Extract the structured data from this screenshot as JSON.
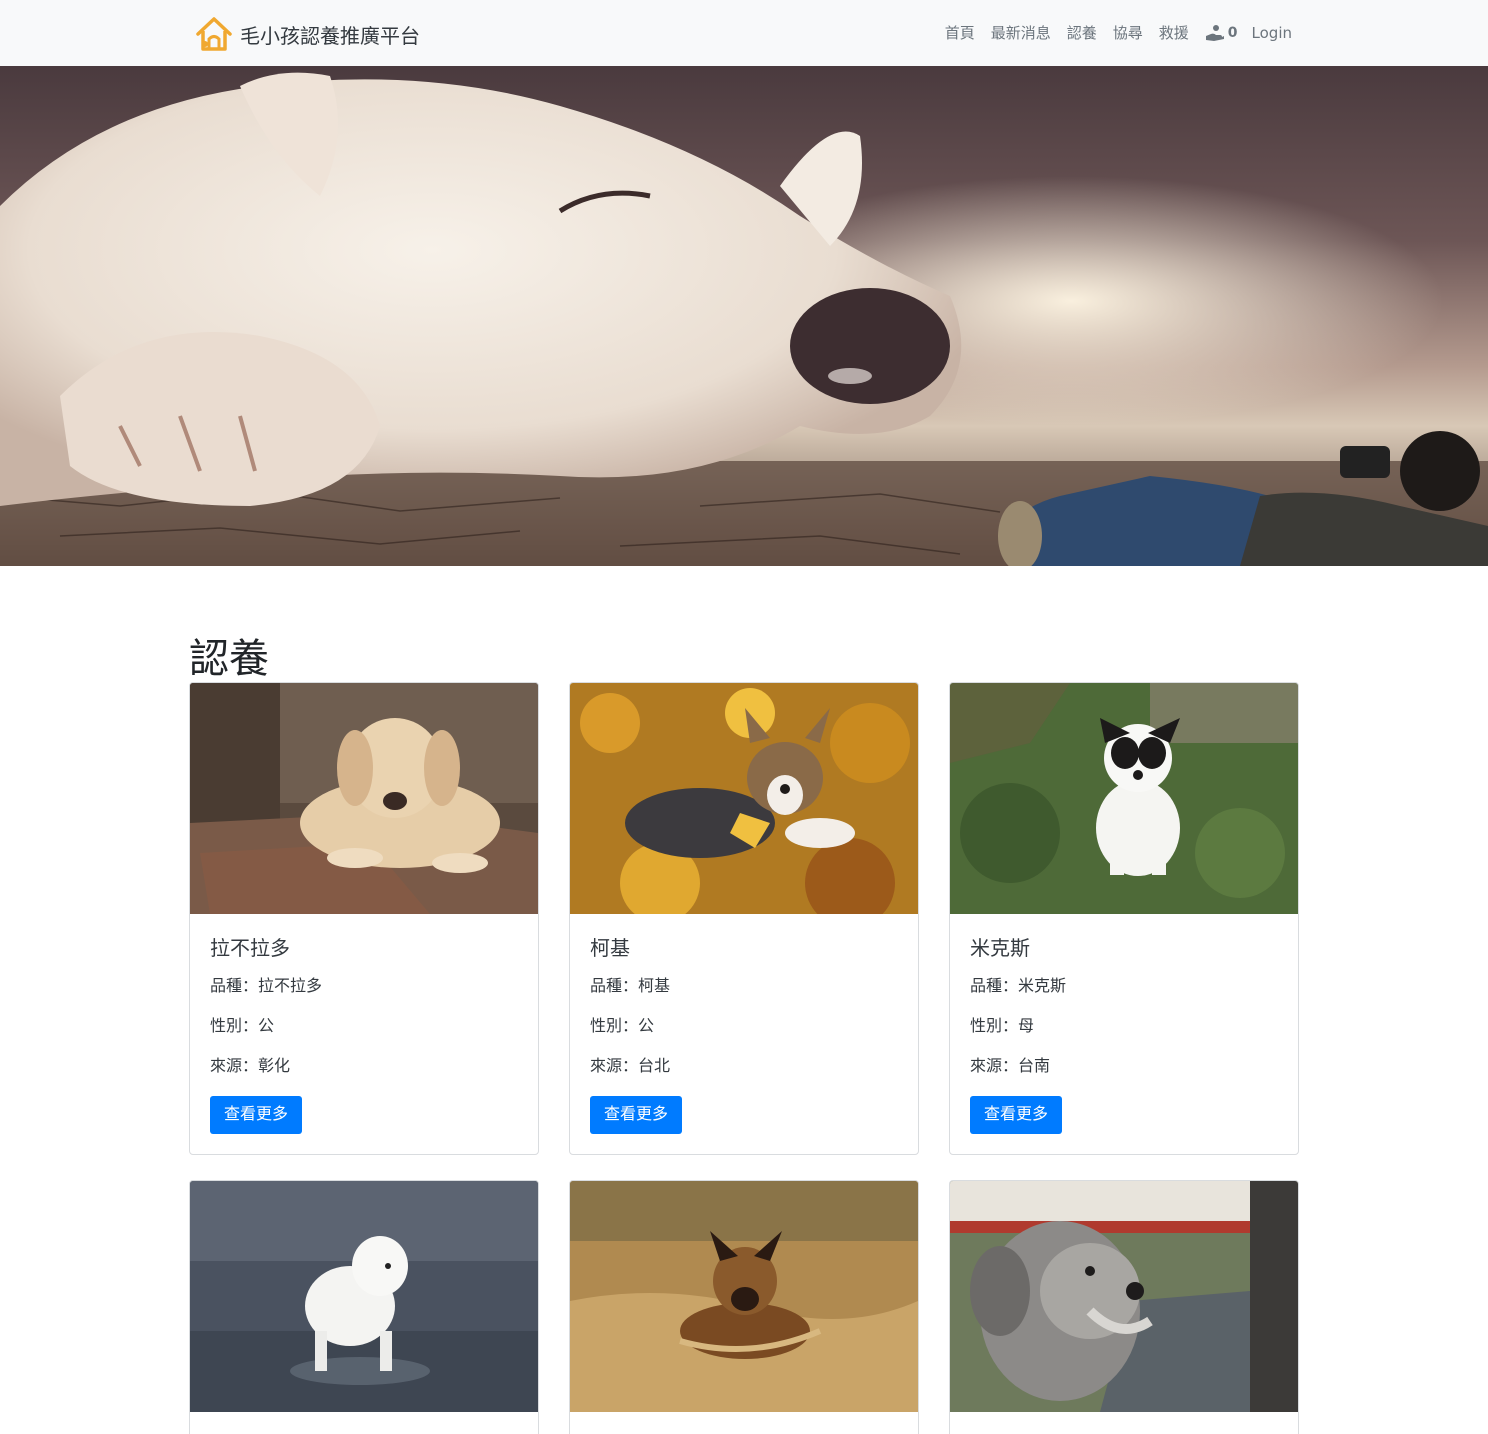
{
  "navbar": {
    "brand": "毛小孩認養推廣平台",
    "links": [
      "首頁",
      "最新消息",
      "認養",
      "協尋",
      "救援"
    ],
    "cart_count": "0",
    "login": "Login",
    "brand_color": "#f0a830"
  },
  "section": {
    "title": "認養"
  },
  "pets": [
    {
      "name": "拉不拉多",
      "breed": "品種：拉不拉多",
      "gender": "性別：公",
      "source": "來源：彰化",
      "button": "查看更多"
    },
    {
      "name": "柯基",
      "breed": "品種：柯基",
      "gender": "性別：公",
      "source": "來源：台北",
      "button": "查看更多"
    },
    {
      "name": "米克斯",
      "breed": "品種：米克斯",
      "gender": "性別：母",
      "source": "來源：台南",
      "button": "查看更多"
    }
  ],
  "colors": {
    "primary": "#007bff",
    "navbar_bg": "#f8f9fa"
  }
}
